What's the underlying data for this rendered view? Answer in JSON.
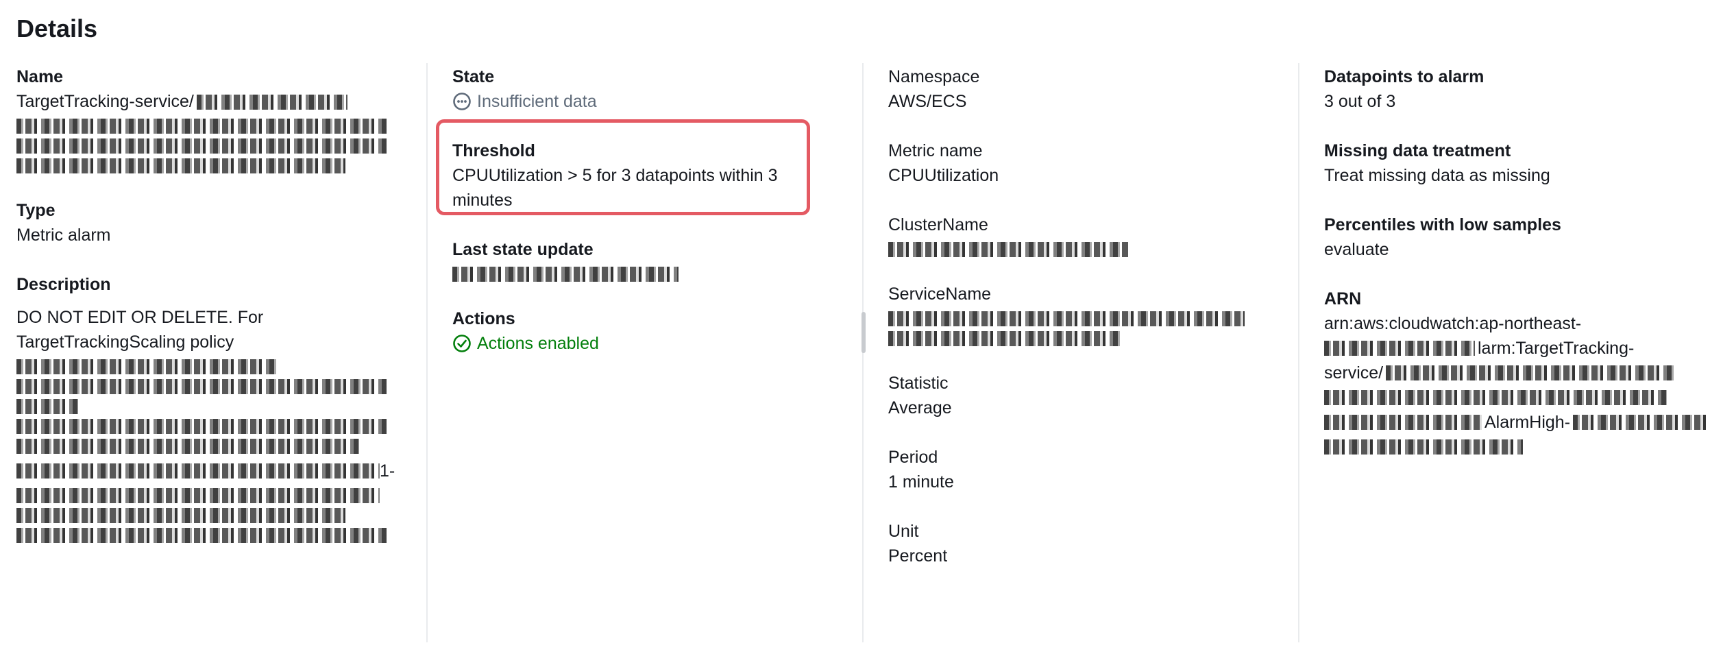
{
  "header": {
    "title": "Details"
  },
  "col1": {
    "name_label": "Name",
    "name_value": "TargetTracking-service/",
    "type_label": "Type",
    "type_value": "Metric alarm",
    "description_label": "Description",
    "description_line1": "DO NOT EDIT OR DELETE. For",
    "description_line2": "TargetTrackingScaling policy",
    "description_fragment": "1-"
  },
  "col2": {
    "state_label": "State",
    "state_value": "Insufficient data",
    "threshold_label": "Threshold",
    "threshold_value": "CPUUtilization > 5 for 3 datapoints within 3 minutes",
    "last_update_label": "Last state update",
    "actions_label": "Actions",
    "actions_value": "Actions enabled"
  },
  "col3": {
    "namespace_label": "Namespace",
    "namespace_value": "AWS/ECS",
    "metric_label": "Metric name",
    "metric_value": "CPUUtilization",
    "cluster_label": "ClusterName",
    "service_label": "ServiceName",
    "statistic_label": "Statistic",
    "statistic_value": "Average",
    "period_label": "Period",
    "period_value": "1 minute",
    "unit_label": "Unit",
    "unit_value": "Percent"
  },
  "col4": {
    "datapoints_label": "Datapoints to alarm",
    "datapoints_value": "3 out of 3",
    "missing_label": "Missing data treatment",
    "missing_value": "Treat missing data as missing",
    "percentiles_label": "Percentiles with low samples",
    "percentiles_value": "evaluate",
    "arn_label": "ARN",
    "arn_line1": "arn:aws:cloudwatch:ap-northeast-",
    "arn_line2": "larm:TargetTracking-",
    "arn_line3": "service/",
    "arn_fragment": "AlarmHigh-"
  },
  "icons": {
    "state": "ellipsis-circle-icon",
    "actions": "check-circle-icon"
  },
  "colors": {
    "text": "#16191f",
    "muted": "#5f6b7a",
    "success": "#037f0c",
    "highlight_border": "#e45a63",
    "divider": "#e9ebed"
  }
}
